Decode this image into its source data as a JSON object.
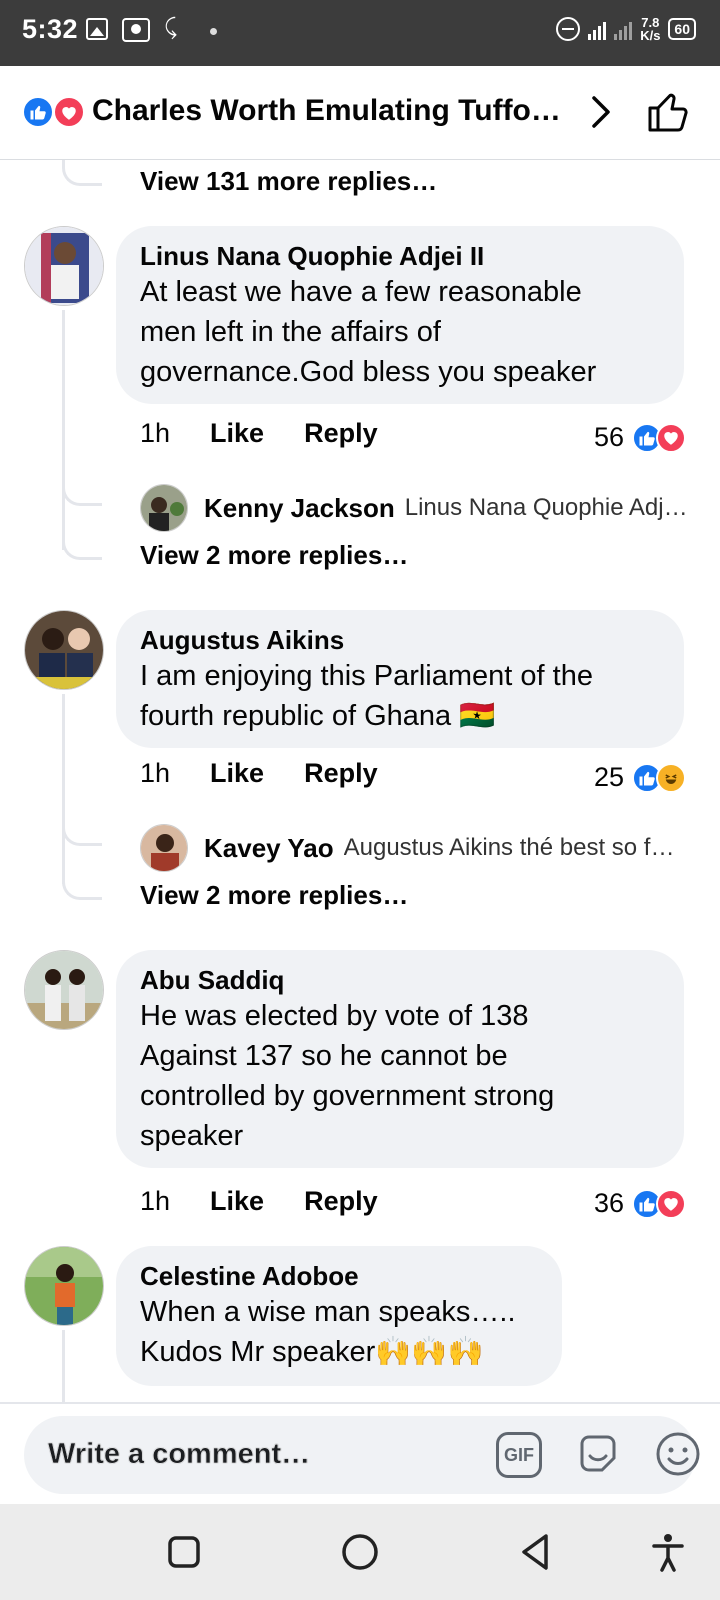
{
  "status_bar": {
    "time": "5:32",
    "network_speed_top": "7.8",
    "network_speed_bottom": "K/s",
    "battery": "60"
  },
  "header": {
    "title": "Charles Worth Emulating Tuffo…"
  },
  "top_view_more": "View 131 more replies…",
  "comments": [
    {
      "name": "Linus Nana Quophie Adjei II",
      "text_lines": [
        "At least we have a few reasonable",
        "men left in the affairs of",
        "governance.God bless you speaker"
      ],
      "time": "1h",
      "like_label": "Like",
      "reply_label": "Reply",
      "reaction_count": "56",
      "reactions": [
        "like",
        "love"
      ],
      "reply_preview": {
        "name": "Kenny Jackson",
        "text": "Linus Nana Quophie Adj…"
      },
      "view_more": "View 2 more replies…"
    },
    {
      "name": "Augustus Aikins",
      "text_lines": [
        "I am enjoying this Parliament of the",
        "fourth republic of Ghana 🇬🇭"
      ],
      "time": "1h",
      "like_label": "Like",
      "reply_label": "Reply",
      "reaction_count": "25",
      "reactions": [
        "like",
        "haha"
      ],
      "reply_preview": {
        "name": "Kavey Yao",
        "text": "Augustus Aikins thé best so f…"
      },
      "view_more": "View 2 more replies…"
    },
    {
      "name": "Abu Saddiq",
      "text_lines": [
        "He was elected by vote of 138",
        "Against 137 so he cannot be",
        "controlled by government strong",
        "speaker"
      ],
      "time": "1h",
      "like_label": "Like",
      "reply_label": "Reply",
      "reaction_count": "36",
      "reactions": [
        "like",
        "love"
      ]
    },
    {
      "name": "Celestine Adoboe",
      "text_lines": [
        "When a wise man speaks…..",
        "Kudos Mr speaker🙌🙌🙌"
      ]
    }
  ],
  "composer": {
    "placeholder": "Write a comment…",
    "gif_label": "GIF"
  }
}
